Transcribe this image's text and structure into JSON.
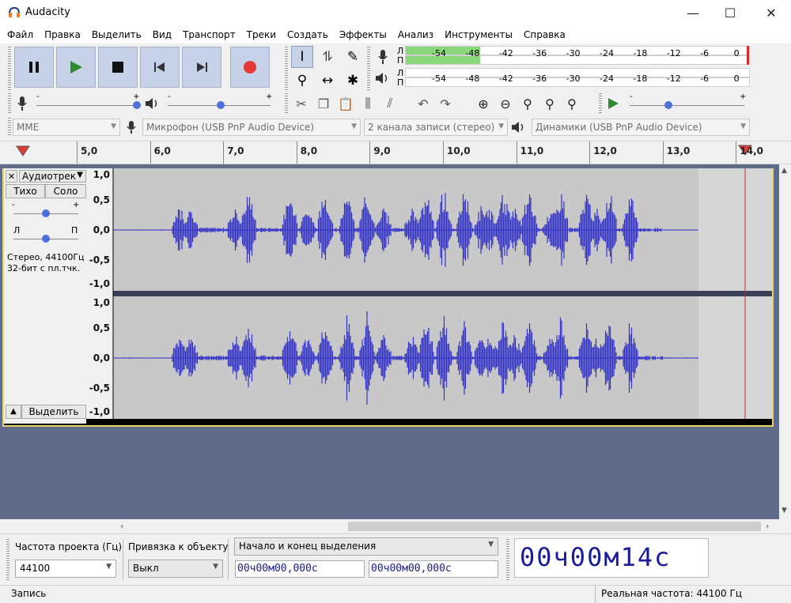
{
  "window": {
    "title": "Audacity",
    "minimize": "—",
    "maximize": "☐",
    "close": "✕"
  },
  "menu": [
    "Файл",
    "Правка",
    "Выделить",
    "Вид",
    "Транспорт",
    "Треки",
    "Создать",
    "Эффекты",
    "Анализ",
    "Инструменты",
    "Справка"
  ],
  "meters": {
    "rec_labels": [
      "Л",
      "П"
    ],
    "play_labels": [
      "Л",
      "П"
    ],
    "scale": [
      "-54",
      "-48",
      "-42",
      "-36",
      "-30",
      "-24",
      "-18",
      "-12",
      "-6",
      "0"
    ]
  },
  "devices": {
    "host": "MME",
    "mic": "Микрофон (USB PnP Audio Device)",
    "channels": "2 канала записи (стерео)",
    "speakers": "Динамики (USB PnP Audio Device)"
  },
  "ruler": {
    "ticks": [
      "5,0",
      "6,0",
      "7,0",
      "8,0",
      "9,0",
      "10,0",
      "11,0",
      "12,0",
      "13,0",
      "14,0"
    ]
  },
  "track": {
    "name": "Аудиотрек",
    "mute": "Тихо",
    "solo": "Соло",
    "gain_minus": "-",
    "gain_plus": "+",
    "pan_left": "Л",
    "pan_right": "П",
    "info_line1": "Стерео, 44100Гц",
    "info_line2": "32-бит с пл.тчк.",
    "collapse": "▲",
    "select": "Выделить",
    "scale": [
      "1,0",
      "0,5",
      "0,0",
      "-0,5",
      "-1,0"
    ]
  },
  "bottom": {
    "rate_label": "Частота проекта (Гц)",
    "rate_value": "44100",
    "snap_label": "Привязка к объекту",
    "snap_value": "Выкл",
    "selection_mode": "Начало и конец выделения",
    "sel_start": "00ч00м00,000с",
    "sel_end": "00ч00м00,000с",
    "position": "00ч00м14с"
  },
  "status": {
    "left": "Запись",
    "right": "Реальная частота: 44100 Гц"
  },
  "colors": {
    "wave": "#3232c8",
    "wave_bg": "#c8c8c8",
    "track_border": "#e9d46a",
    "meter_green": "#8ad87a",
    "record": "#e53935",
    "play": "#2e8b2e",
    "playhead": "#c62828"
  }
}
